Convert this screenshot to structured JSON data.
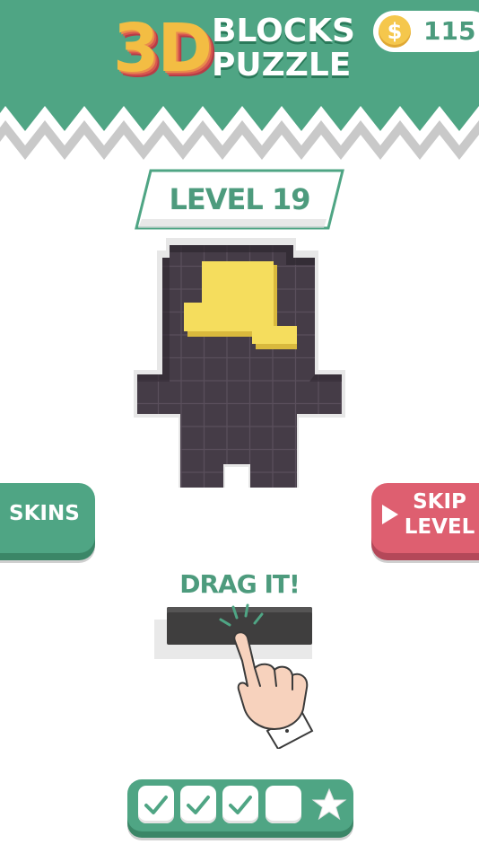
{
  "header": {
    "logo_3d": "3D",
    "logo_line1": "BLOCKS",
    "logo_line2": "PUZZLE",
    "coin_icon": "coin-dollar-icon",
    "coin_symbol": "$",
    "coins": "115",
    "bg_color": "#4fa584"
  },
  "level": {
    "label": "LEVEL 19"
  },
  "buttons": {
    "skins": "SKINS",
    "skip_line1": "SKIP",
    "skip_line2": "LEVEL"
  },
  "tutorial": {
    "label": "DRAG IT!"
  },
  "progress": {
    "stages": [
      {
        "state": "done",
        "icon": "checkmark-icon"
      },
      {
        "state": "done",
        "icon": "checkmark-icon"
      },
      {
        "state": "done",
        "icon": "checkmark-icon"
      },
      {
        "state": "empty",
        "icon": ""
      },
      {
        "state": "bonus",
        "icon": "star-icon"
      }
    ]
  },
  "colors": {
    "green": "#4fa584",
    "red": "#de5f70",
    "block_yellow": "#f5dd5d",
    "board_dark": "#453c47"
  }
}
